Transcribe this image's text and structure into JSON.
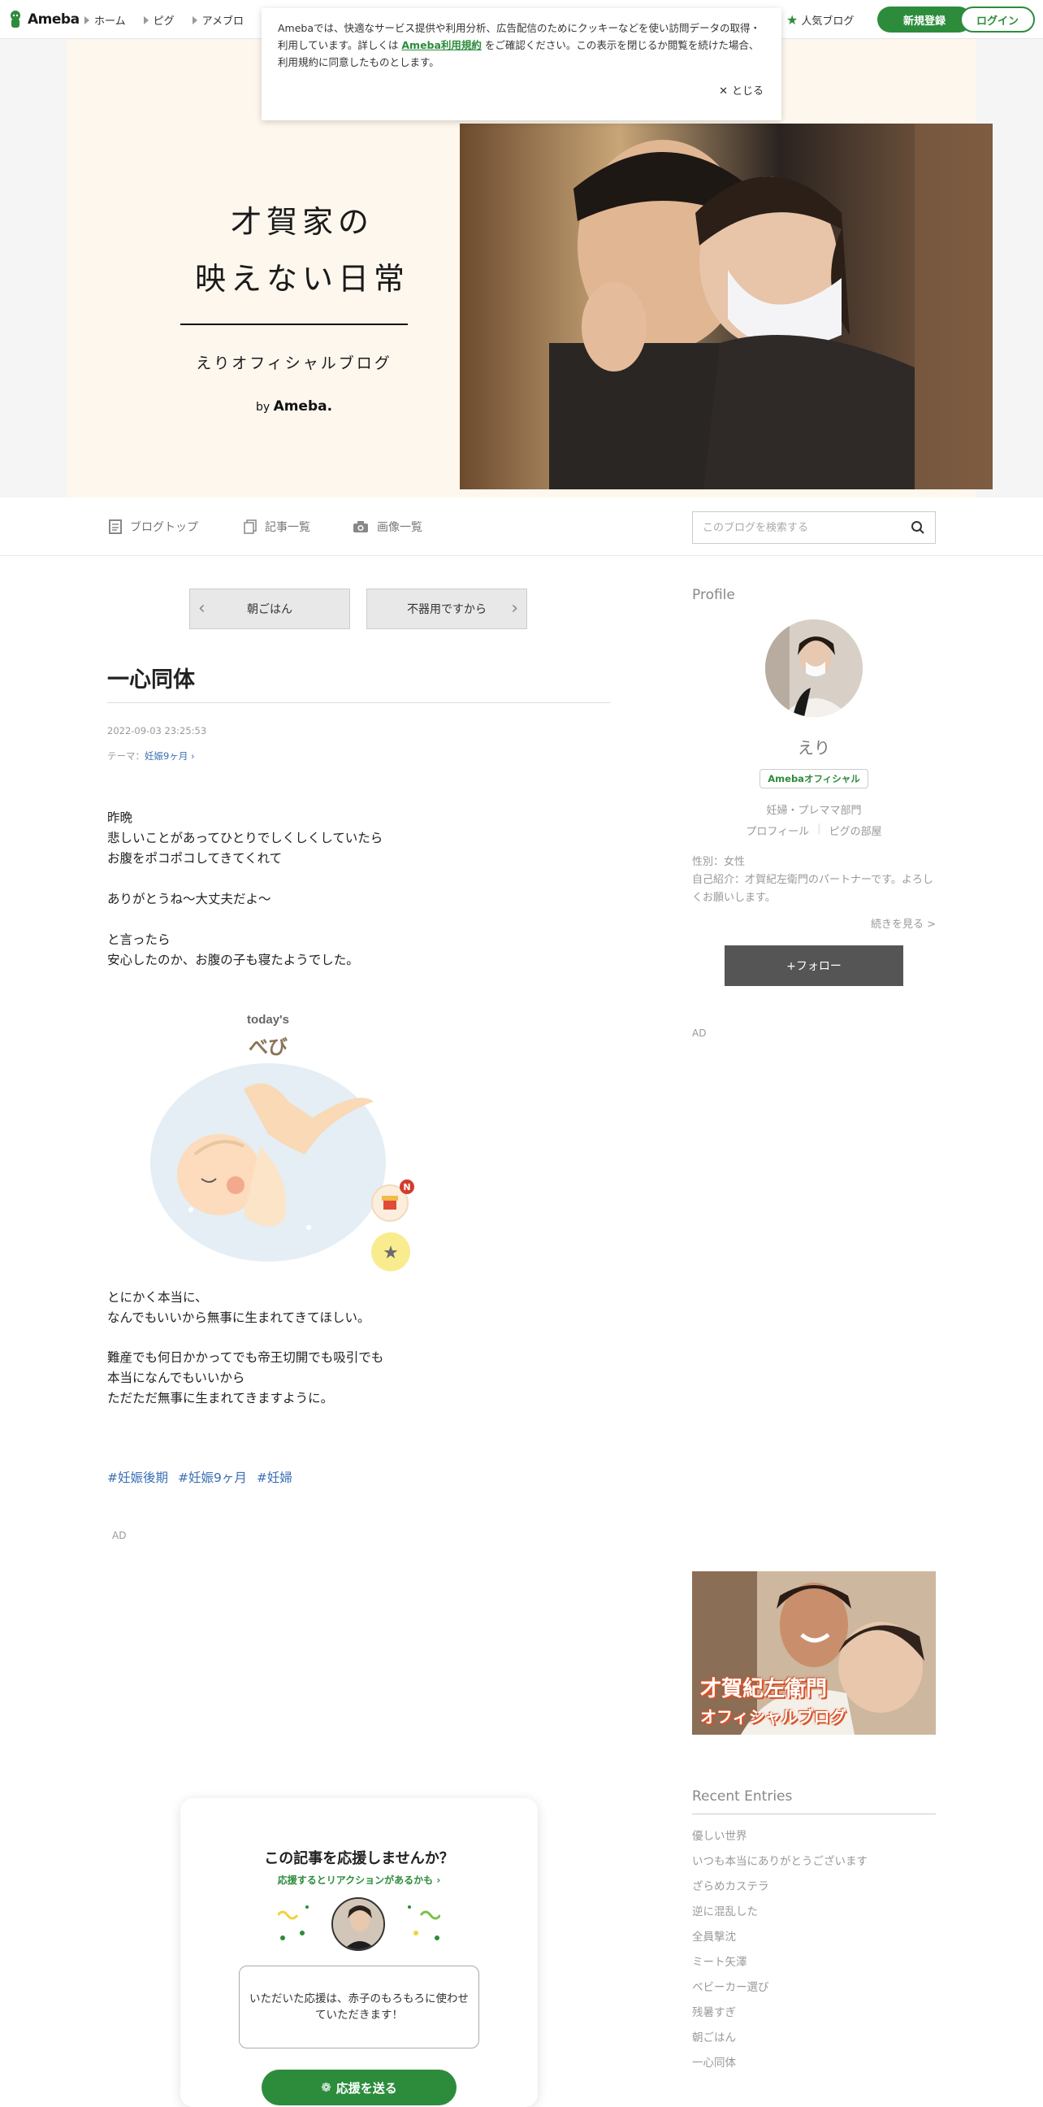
{
  "global_header": {
    "logo": "Ameba",
    "nav": [
      "ホーム",
      "ピグ",
      "アメブロ"
    ],
    "popular": "人気ブログ",
    "register": "新規登録",
    "login": "ログイン"
  },
  "cookie": {
    "text_before": "Amebaでは、快適なサービス提供や利用分析、広告配信のためにクッキーなどを使い訪問データの取得・利用しています。詳しくは",
    "link": "Ameba利用規約",
    "text_after": "をご確認ください。この表示を閉じるか閲覧を続けた場合、利用規約に同意したものとします。",
    "close": "とじる"
  },
  "hero": {
    "title_line1": "才賀家の",
    "title_line2": "映えない日常",
    "subtitle": "えりオフィシャルブログ",
    "by": "by",
    "by_brand": "Ameba."
  },
  "blog_nav": {
    "top": "ブログトップ",
    "entries": "記事一覧",
    "images": "画像一覧",
    "search_placeholder": "このブログを検索する"
  },
  "pager": {
    "prev": "朝ごはん",
    "next": "不器用ですから"
  },
  "article": {
    "title": "一心同体",
    "date": "2022-09-03 23:25:53",
    "theme_label": "テーマ：",
    "theme": "妊娠9ヶ月",
    "para1": [
      "昨晩",
      "悲しいことがあってひとりでしくしくしていたら",
      "お腹をポコポコしてきてくれて"
    ],
    "para2": [
      "ありがとうね〜大丈夫だよ〜"
    ],
    "para3": [
      "と言ったら",
      "安心したのか、お腹の子も寝たようでした。"
    ],
    "baby_heading": "today's",
    "baby_name": "べび",
    "para4": [
      "とにかく本当に、",
      "なんでもいいから無事に生まれてきてほしい。"
    ],
    "para5": [
      "難産でも何日かかってでも帝王切開でも吸引でも",
      "本当になんでもいいから",
      "ただただ無事に生まれてきますように。"
    ],
    "tags": [
      "#妊娠後期",
      "#妊娠9ヶ月",
      "#妊婦"
    ],
    "ad_label": "AD"
  },
  "support_card": {
    "title": "この記事を応援しませんか？",
    "link": "応援するとリアクションがあるかも",
    "bubble": "いただいた応援は、赤子のもろもろに使わせていただきます！",
    "button": "応援を送る"
  },
  "sidebar": {
    "profile_heading": "Profile",
    "name": "えり",
    "badge": "Amebaオフィシャル",
    "category": "妊婦・プレママ部門",
    "profile_link": "プロフィール",
    "pig_link": "ピグの部屋",
    "gender": "性別：女性",
    "intro": "自己紹介：才賀紀左衛門のパートナーです。よろしくお願いします。",
    "more": "続きを見る >",
    "follow": "+フォロー",
    "ad_label": "AD",
    "banner_line1": "才賀紀左衛門",
    "banner_line2": "オフィシャルブログ",
    "recent_heading": "Recent Entries",
    "recent": [
      "優しい世界",
      "いつも本当にありがとうございます",
      "ざらめカステラ",
      "逆に混乱した",
      "全員撃沈",
      "ミート矢澤",
      "ベビーカー選び",
      "残暑すぎ",
      "朝ごはん",
      "一心同体"
    ]
  }
}
